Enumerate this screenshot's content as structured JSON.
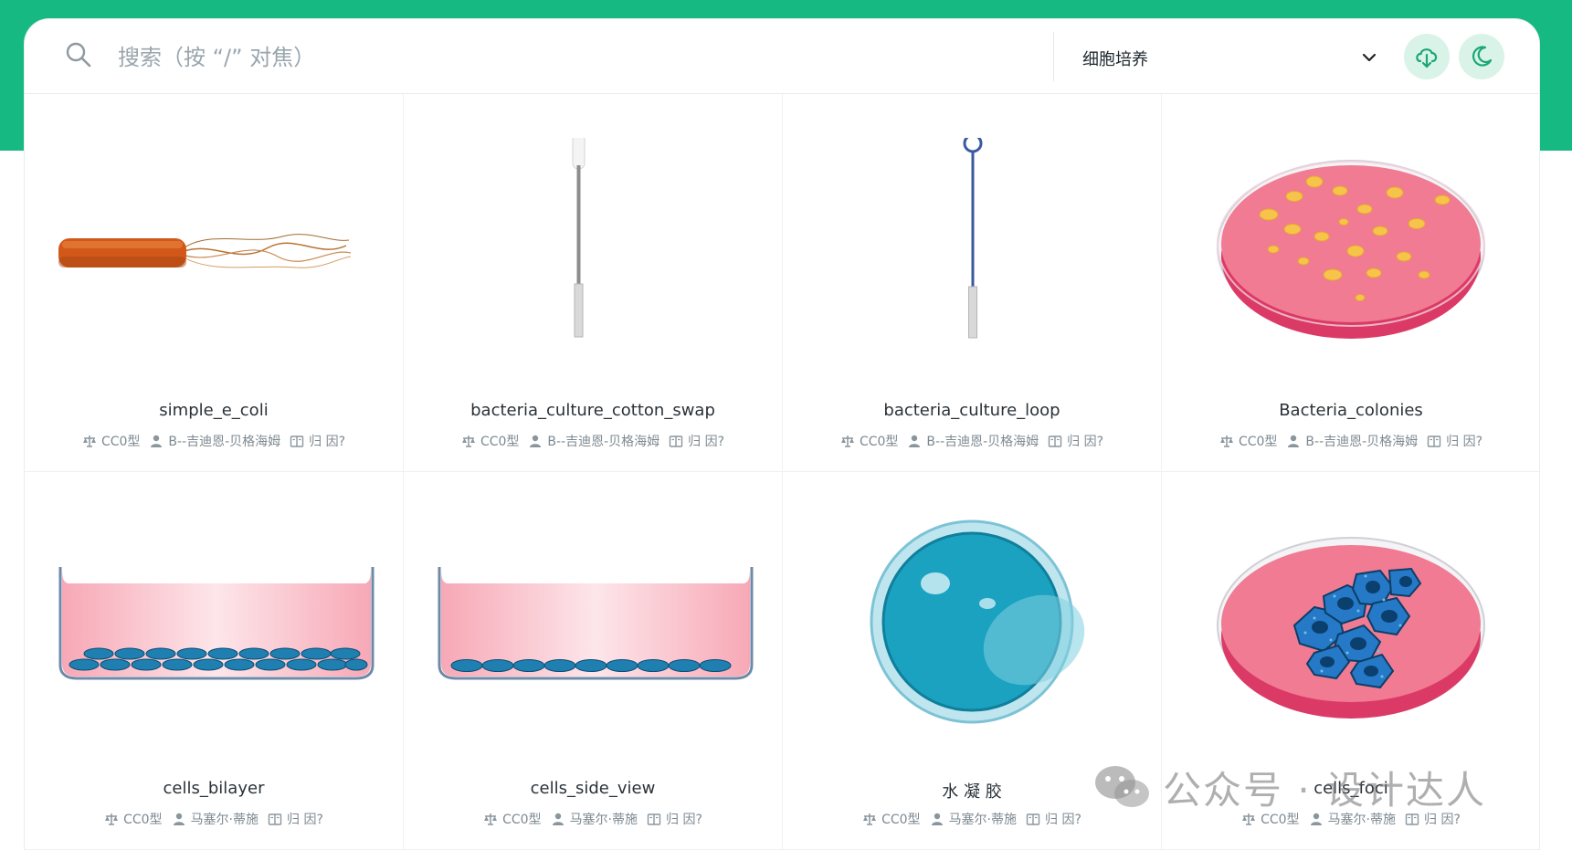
{
  "search": {
    "placeholder": "搜索（按 “/” 对焦）"
  },
  "category": {
    "selected": "细胞培养"
  },
  "toolbar": {
    "download_label": "下载",
    "theme_label": "暗色模式"
  },
  "colors": {
    "brand": "#16b981",
    "button_bg": "#d9f3e8",
    "icon_green": "#1aa874"
  },
  "cards": [
    {
      "title": "simple_e_coli",
      "license": "CC0型",
      "author": "B--吉迪恩-贝格海姆",
      "cite": "归 因?",
      "icon": "e-coli-illustration"
    },
    {
      "title": "bacteria_culture_cotton_swap",
      "license": "CC0型",
      "author": "B--吉迪恩-贝格海姆",
      "cite": "归 因?",
      "icon": "cotton-swab-illustration"
    },
    {
      "title": "bacteria_culture_loop",
      "license": "CC0型",
      "author": "B--吉迪恩-贝格海姆",
      "cite": "归 因?",
      "icon": "inoculation-loop-illustration"
    },
    {
      "title": "Bacteria_colonies",
      "license": "CC0型",
      "author": "B--吉迪恩-贝格海姆",
      "cite": "归 因?",
      "icon": "petri-dish-colonies-illustration"
    },
    {
      "title": "cells_bilayer",
      "license": "CC0型",
      "author": "马塞尔·蒂施",
      "cite": "归 因?",
      "icon": "cells-bilayer-illustration"
    },
    {
      "title": "cells_side_view",
      "license": "CC0型",
      "author": "马塞尔·蒂施",
      "cite": "归 因?",
      "icon": "cells-side-view-illustration"
    },
    {
      "title": "水 凝 胶",
      "license": "CC0型",
      "author": "马塞尔·蒂施",
      "cite": "归 因?",
      "icon": "hydrogel-illustration"
    },
    {
      "title": "cells_foci",
      "license": "CC0型",
      "author": "马塞尔·蒂施",
      "cite": "归 因?",
      "icon": "cells-foci-illustration"
    }
  ],
  "watermark": {
    "text": "公众号 · 设计达人"
  }
}
